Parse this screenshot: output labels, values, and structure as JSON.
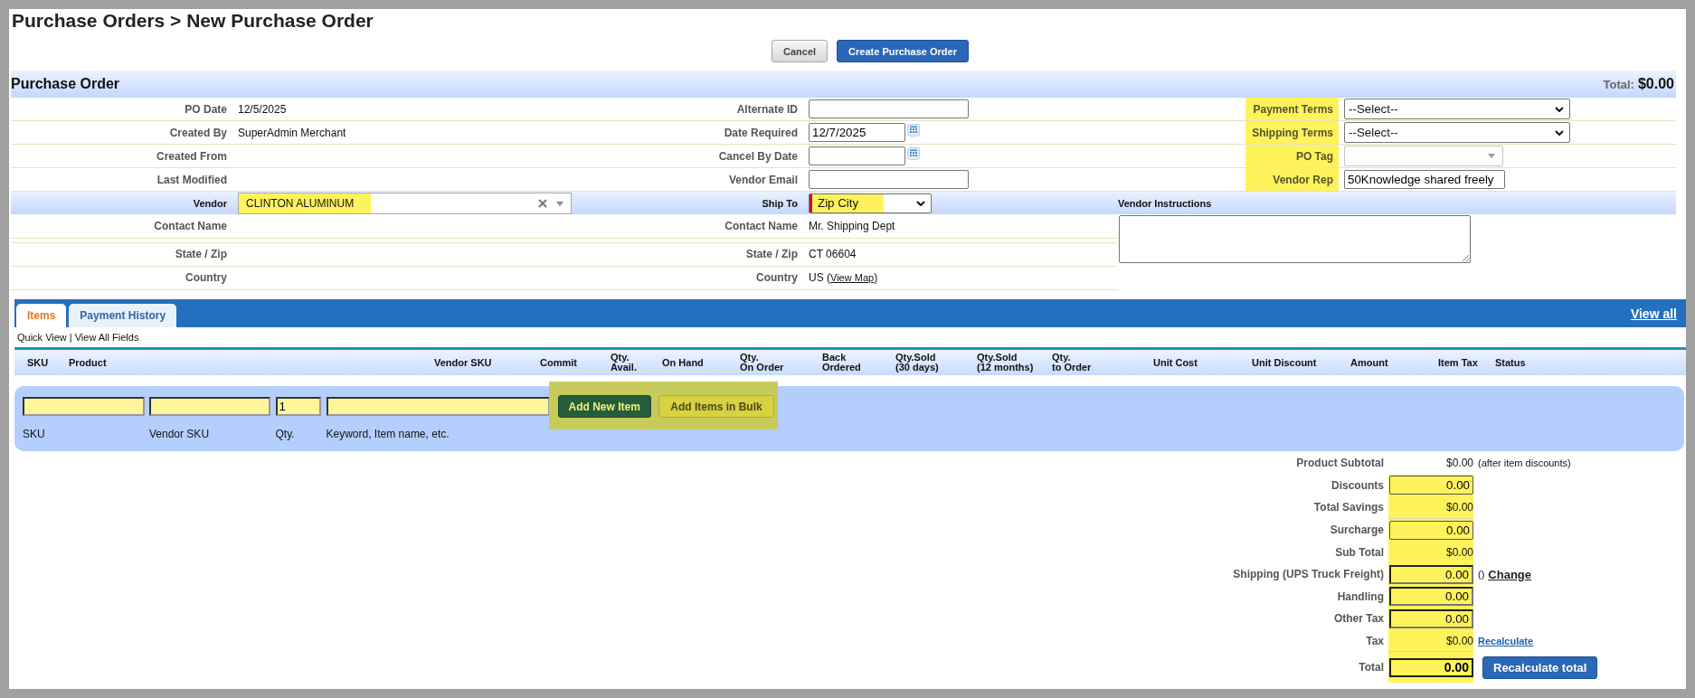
{
  "page_title": "Purchase Orders > New Purchase Order",
  "actions": [
    {
      "label": "Cancel",
      "kind": "cancel"
    },
    {
      "label": "Create Purchase Order",
      "kind": "create"
    }
  ],
  "purchase_order": {
    "title": "Purchase Order",
    "total_label": "Total:",
    "total_value": "$0.00",
    "left_fields": [
      {
        "label": "PO Date",
        "value": "12/5/2025"
      },
      {
        "label": "Created By",
        "value": "SuperAdmin Merchant"
      },
      {
        "label": "Created From"
      },
      {
        "label": "Last Modified"
      }
    ],
    "middle_fields": [
      {
        "label": "Alternate ID",
        "kind": "text"
      },
      {
        "label": "Date Required",
        "kind": "date",
        "value": "12/7/2025"
      },
      {
        "label": "Cancel By Date",
        "kind": "date"
      },
      {
        "label": "Vendor Email",
        "kind": "text"
      }
    ],
    "right_fields": [
      {
        "label": "Payment Terms",
        "kind": "select",
        "value": "--Select--",
        "highlighted": true
      },
      {
        "label": "Shipping Terms",
        "kind": "select",
        "value": "--Select--",
        "highlighted": true
      },
      {
        "label": "PO Tag",
        "kind": "combo",
        "highlighted": true
      },
      {
        "label": "Vendor Rep",
        "kind": "text",
        "value": "50Knowledge shared freely",
        "highlighted": true
      }
    ]
  },
  "vendor": {
    "label": "Vendor",
    "kind": "combobox",
    "value": "CLINTON ALUMINUM",
    "highlighted": true,
    "required": false,
    "details": [
      {
        "label": "Contact Name"
      },
      {
        "label": "State / Zip"
      },
      {
        "label": "Country"
      }
    ]
  },
  "ship_to": {
    "label": "Ship To",
    "kind": "select",
    "value": "Zip City",
    "highlighted": true,
    "required": true,
    "details": [
      {
        "label": "Contact Name",
        "value": "Mr. Shipping Dept"
      },
      {
        "label": "State / Zip",
        "value": "CT 06604"
      },
      {
        "label": "Country",
        "value": "US",
        "link_prefix": "(",
        "link": "View Map",
        "link_suffix": ")"
      }
    ]
  },
  "vendor_instructions": {
    "label": "Vendor Instructions"
  },
  "items": {
    "tabs": [
      {
        "label": "Items",
        "selected": true
      },
      {
        "label": "Payment History",
        "selected": false
      }
    ],
    "view_all": "View all",
    "views": [
      "Quick View",
      "View All Fields"
    ],
    "views_separator": "|",
    "columns": [
      "SKU",
      "Product",
      "Vendor SKU",
      "Commit",
      "Qty.\nAvail.",
      "On Hand",
      "Qty.\nOn Order",
      "Back\nOrdered",
      "Qty.Sold\n(30 days)",
      "Qty.Sold\n(12 months)",
      "Qty.\nto Order",
      "Unit Cost",
      "Unit Discount",
      "Amount",
      "Item Tax",
      "Status"
    ]
  },
  "add_item": {
    "fields": [
      {
        "label": "SKU"
      },
      {
        "label": "Vendor SKU"
      },
      {
        "label": "Qty.",
        "value": "1"
      },
      {
        "label": "Keyword, Item name, etc."
      }
    ],
    "buttons": [
      {
        "label": "Add New Item",
        "kind": "add"
      },
      {
        "label": "Add Items in Bulk",
        "kind": "bulk"
      }
    ],
    "highlighted": true
  },
  "totals": [
    {
      "label": "Product Subtotal",
      "kind": "text",
      "value": "$0.00",
      "note": "(after item discounts)",
      "highlighted": false,
      "rule_below": false
    },
    {
      "label": "Discounts",
      "kind": "field",
      "value": "0.00",
      "highlighted": true,
      "rule_below": false
    },
    {
      "label": "Total Savings",
      "kind": "text",
      "value": "$0.00",
      "highlighted": true,
      "rule_below": true
    },
    {
      "label": "Surcharge",
      "kind": "field",
      "value": "0.00",
      "highlighted": true,
      "rule_below": false
    },
    {
      "label": "Sub Total",
      "kind": "text",
      "value": "$0.00",
      "highlighted": true,
      "rule_below": false
    },
    {
      "label": "Shipping (UPS Truck Freight)",
      "kind": "input",
      "value": "0.00",
      "note": "()",
      "link": {
        "label": "Change",
        "kind": "action"
      },
      "highlighted": true,
      "rule_below": false
    },
    {
      "label": "Handling",
      "kind": "input",
      "value": "0.00",
      "highlighted": true,
      "rule_below": false
    },
    {
      "label": "Other Tax",
      "kind": "input",
      "value": "0.00",
      "highlighted": true,
      "rule_below": false
    },
    {
      "label": "Tax",
      "kind": "text",
      "value": "$0.00",
      "link": {
        "label": "Recalculate",
        "kind": "inline"
      },
      "highlighted": true,
      "rule_below": true
    },
    {
      "label": "Total",
      "kind": "total",
      "value": "0.00",
      "button": "Recalculate total",
      "highlighted": true,
      "rule_below": false
    }
  ]
}
